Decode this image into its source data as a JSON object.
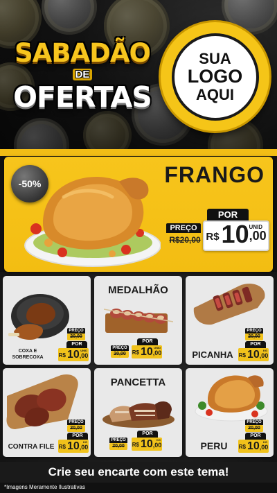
{
  "header": {
    "title_line1": "SABADÃO",
    "title_line2": "DE",
    "title_line3": "OFERTAS",
    "logo_line1": "SUA",
    "logo_line2": "LOGO",
    "logo_line3": "AQUI"
  },
  "featured": {
    "name": "FRANGO",
    "discount": "-50%",
    "por": "POR",
    "preco": "PREÇO",
    "old_price": "R$20,00",
    "currency": "R$",
    "price_int": "10",
    "price_dec": ",00",
    "unit": "UNID"
  },
  "products": [
    {
      "name_line1": "COXA E",
      "name_line2": "SOBRECOXA",
      "preco": "PREÇO",
      "old_price": "20,00",
      "por": "POR",
      "currency": "R$",
      "price_int": "10",
      "price_dec": ",00",
      "unit": "UNID"
    },
    {
      "name": "MEDALHÃO",
      "preco": "PREÇO",
      "old_price": "20,00",
      "por": "POR",
      "currency": "R$",
      "price_int": "10",
      "price_dec": ",00",
      "unit": "UNID"
    },
    {
      "name": "PICANHA",
      "preco": "PREÇO",
      "old_price": "20,00",
      "por": "POR",
      "currency": "R$",
      "price_int": "10",
      "price_dec": ",00",
      "unit": "KG"
    },
    {
      "name": "CONTRA FILE",
      "preco": "PREÇO",
      "old_price": "20,00",
      "por": "POR",
      "currency": "R$",
      "price_int": "10",
      "price_dec": ",00",
      "unit": "KG"
    },
    {
      "name": "PANCETTA",
      "preco": "PREÇO",
      "old_price": "20,00",
      "por": "POR",
      "currency": "R$",
      "price_int": "10",
      "price_dec": ",00",
      "unit": "KG"
    },
    {
      "name": "PERU",
      "preco": "PREÇO",
      "old_price": "20,00",
      "por": "POR",
      "currency": "R$",
      "price_int": "10",
      "price_dec": ",00",
      "unit": "KG"
    }
  ],
  "cta": "Crie seu encarte com este tema!",
  "disclaimer": "*Imagens Meramente Ilustrativas",
  "colors": {
    "accent": "#f2bd16",
    "dark": "#1a1a1a",
    "card": "#e9e9e9"
  }
}
